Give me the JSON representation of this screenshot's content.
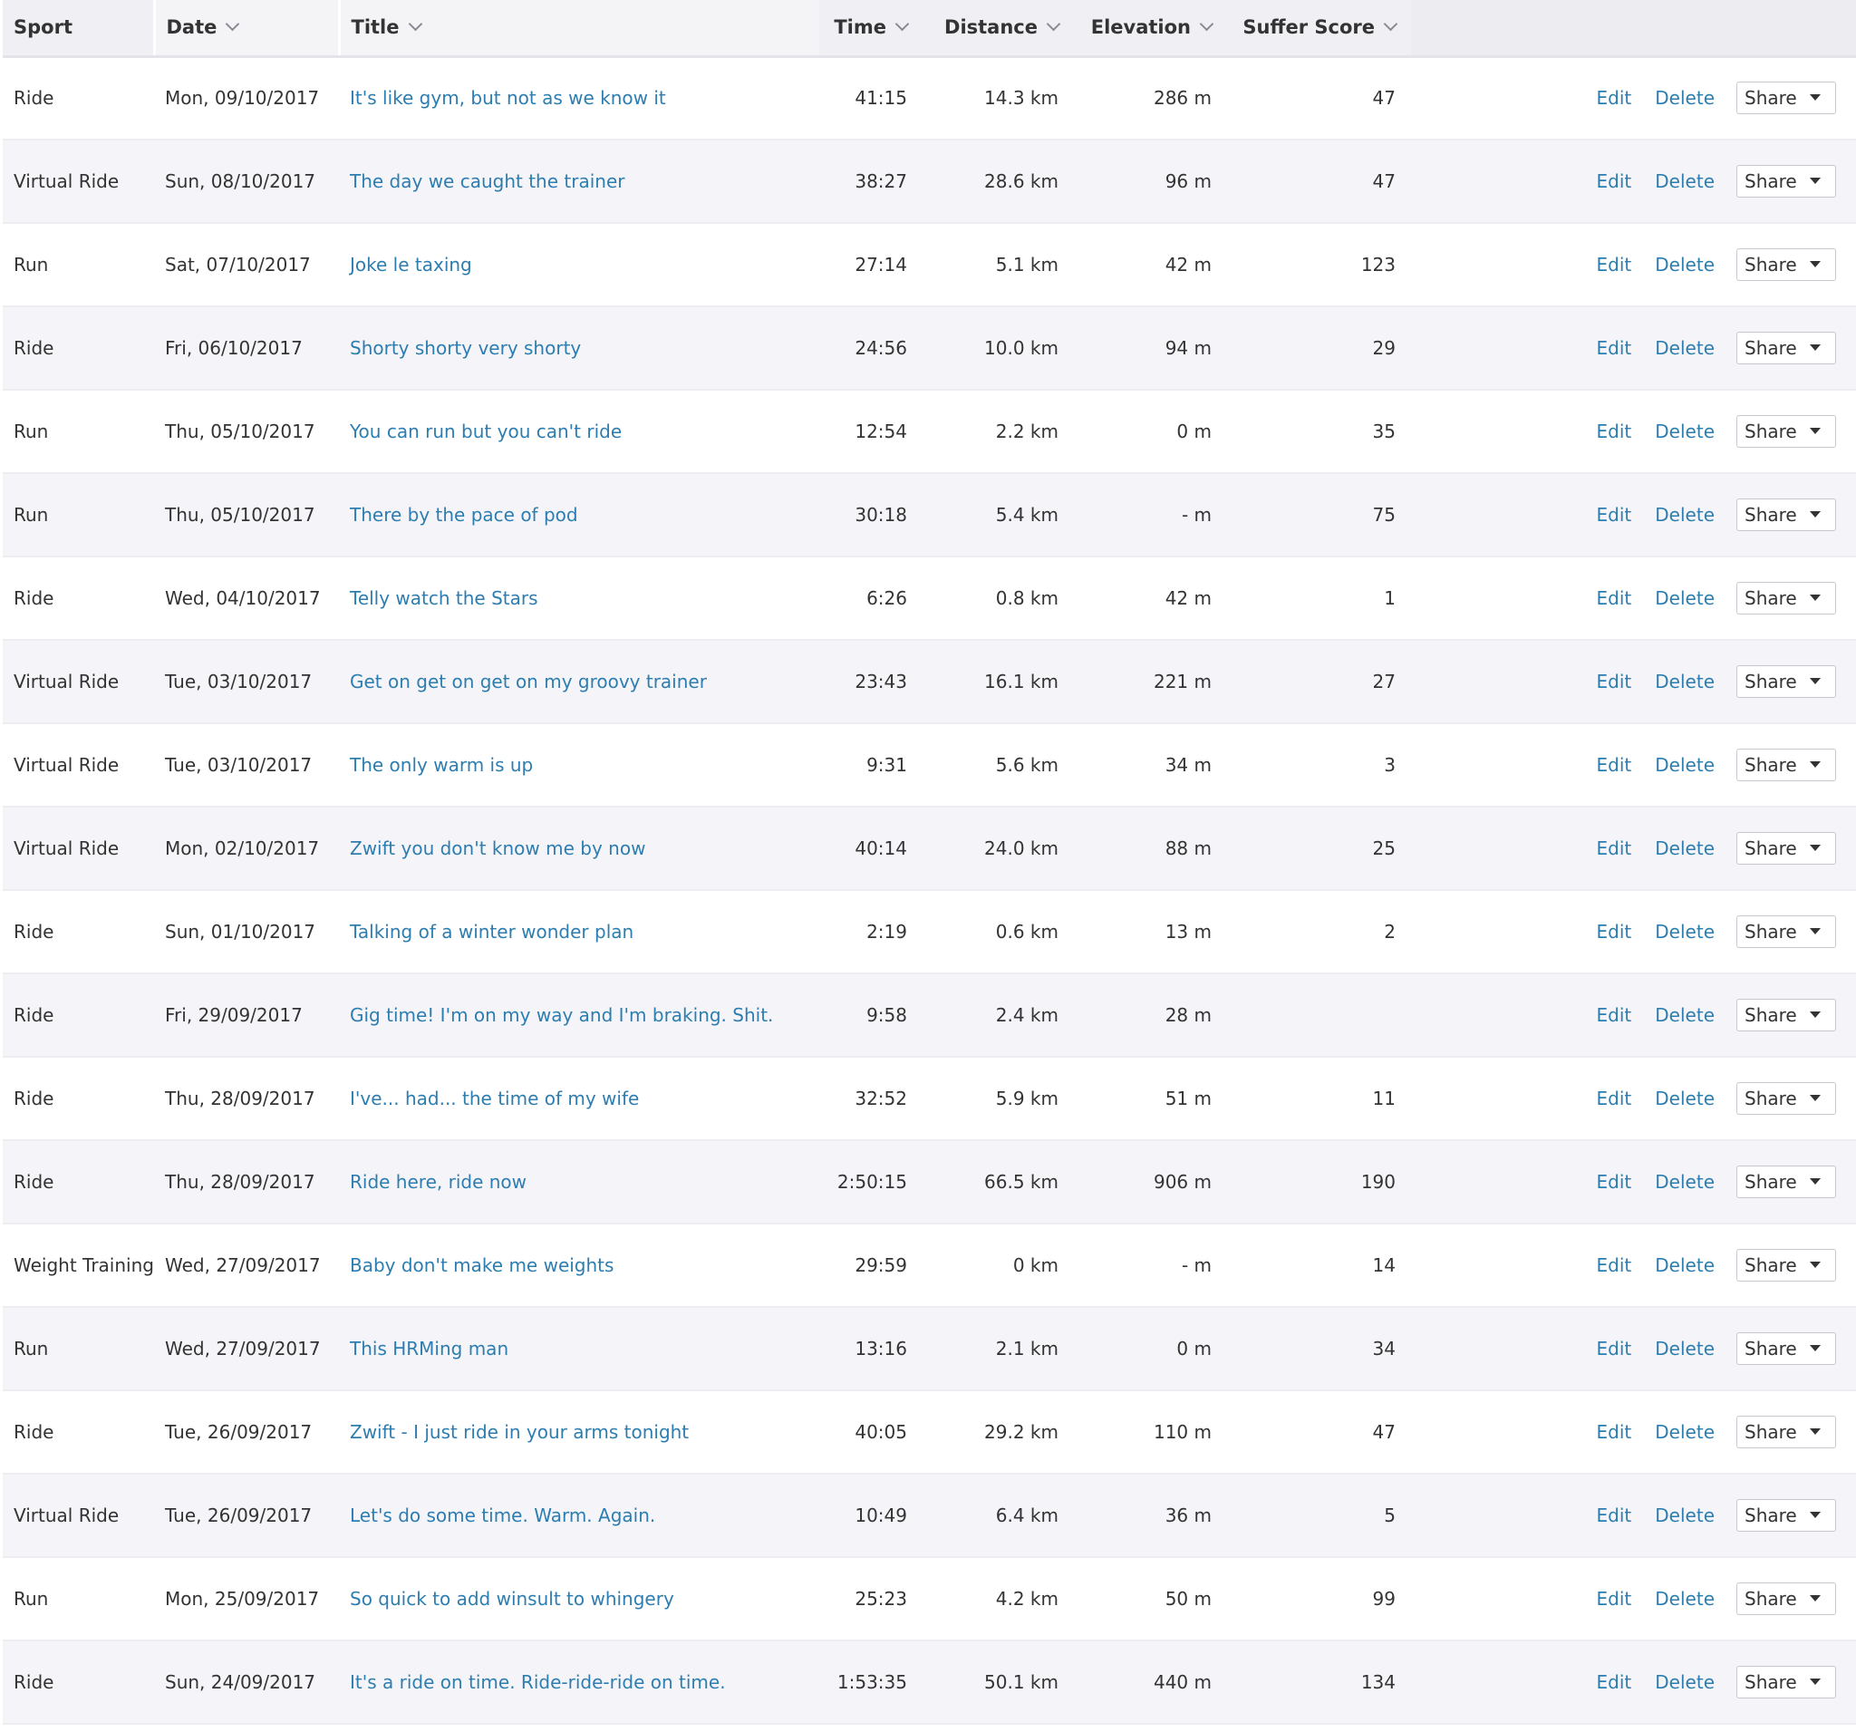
{
  "columns": {
    "sport": "Sport",
    "date": "Date",
    "title": "Title",
    "time": "Time",
    "distance": "Distance",
    "elevation": "Elevation",
    "suffer_score": "Suffer Score"
  },
  "actions": {
    "edit": "Edit",
    "delete": "Delete",
    "share": "Share"
  },
  "colors": {
    "link": "#2d7db0",
    "header_bg": "#f0f0f4",
    "row_alt_bg": "#f5f5f9"
  },
  "rows": [
    {
      "sport": "Ride",
      "date": "Mon, 09/10/2017",
      "title": "It's like gym, but not as we know it",
      "time": "41:15",
      "distance": "14.3 km",
      "elevation": "286 m",
      "suffer_score": "47"
    },
    {
      "sport": "Virtual Ride",
      "date": "Sun, 08/10/2017",
      "title": "The day we caught the trainer",
      "time": "38:27",
      "distance": "28.6 km",
      "elevation": "96 m",
      "suffer_score": "47"
    },
    {
      "sport": "Run",
      "date": "Sat, 07/10/2017",
      "title": "Joke le taxing",
      "time": "27:14",
      "distance": "5.1 km",
      "elevation": "42 m",
      "suffer_score": "123"
    },
    {
      "sport": "Ride",
      "date": "Fri, 06/10/2017",
      "title": "Shorty shorty very shorty",
      "time": "24:56",
      "distance": "10.0 km",
      "elevation": "94 m",
      "suffer_score": "29"
    },
    {
      "sport": "Run",
      "date": "Thu, 05/10/2017",
      "title": "You can run but you can't ride",
      "time": "12:54",
      "distance": "2.2 km",
      "elevation": "0 m",
      "suffer_score": "35"
    },
    {
      "sport": "Run",
      "date": "Thu, 05/10/2017",
      "title": "There by the pace of pod",
      "time": "30:18",
      "distance": "5.4 km",
      "elevation": "- m",
      "suffer_score": "75"
    },
    {
      "sport": "Ride",
      "date": "Wed, 04/10/2017",
      "title": "Telly watch the Stars",
      "time": "6:26",
      "distance": "0.8 km",
      "elevation": "42 m",
      "suffer_score": "1"
    },
    {
      "sport": "Virtual Ride",
      "date": "Tue, 03/10/2017",
      "title": "Get on get on get on my groovy trainer",
      "time": "23:43",
      "distance": "16.1 km",
      "elevation": "221 m",
      "suffer_score": "27"
    },
    {
      "sport": "Virtual Ride",
      "date": "Tue, 03/10/2017",
      "title": "The only warm is up",
      "time": "9:31",
      "distance": "5.6 km",
      "elevation": "34 m",
      "suffer_score": "3"
    },
    {
      "sport": "Virtual Ride",
      "date": "Mon, 02/10/2017",
      "title": "Zwift you don't know me by now",
      "time": "40:14",
      "distance": "24.0 km",
      "elevation": "88 m",
      "suffer_score": "25"
    },
    {
      "sport": "Ride",
      "date": "Sun, 01/10/2017",
      "title": "Talking of a winter wonder plan",
      "time": "2:19",
      "distance": "0.6 km",
      "elevation": "13 m",
      "suffer_score": "2"
    },
    {
      "sport": "Ride",
      "date": "Fri, 29/09/2017",
      "title": "Gig time! I'm on my way and I'm braking. Shit.",
      "time": "9:58",
      "distance": "2.4 km",
      "elevation": "28 m",
      "suffer_score": ""
    },
    {
      "sport": "Ride",
      "date": "Thu, 28/09/2017",
      "title": "I've... had... the time of my wife",
      "time": "32:52",
      "distance": "5.9 km",
      "elevation": "51 m",
      "suffer_score": "11"
    },
    {
      "sport": "Ride",
      "date": "Thu, 28/09/2017",
      "title": "Ride here, ride now",
      "time": "2:50:15",
      "distance": "66.5 km",
      "elevation": "906 m",
      "suffer_score": "190"
    },
    {
      "sport": "Weight Training",
      "date": "Wed, 27/09/2017",
      "title": "Baby don't make me weights",
      "time": "29:59",
      "distance": "0 km",
      "elevation": "- m",
      "suffer_score": "14"
    },
    {
      "sport": "Run",
      "date": "Wed, 27/09/2017",
      "title": "This HRMing man",
      "time": "13:16",
      "distance": "2.1 km",
      "elevation": "0 m",
      "suffer_score": "34"
    },
    {
      "sport": "Ride",
      "date": "Tue, 26/09/2017",
      "title": "Zwift - I just ride in your arms tonight",
      "time": "40:05",
      "distance": "29.2 km",
      "elevation": "110 m",
      "suffer_score": "47"
    },
    {
      "sport": "Virtual Ride",
      "date": "Tue, 26/09/2017",
      "title": "Let's do some time. Warm. Again.",
      "time": "10:49",
      "distance": "6.4 km",
      "elevation": "36 m",
      "suffer_score": "5"
    },
    {
      "sport": "Run",
      "date": "Mon, 25/09/2017",
      "title": "So quick to add winsult to whingery",
      "time": "25:23",
      "distance": "4.2 km",
      "elevation": "50 m",
      "suffer_score": "99"
    },
    {
      "sport": "Ride",
      "date": "Sun, 24/09/2017",
      "title": "It's a ride on time. Ride-ride-ride on time.",
      "time": "1:53:35",
      "distance": "50.1 km",
      "elevation": "440 m",
      "suffer_score": "134"
    }
  ]
}
